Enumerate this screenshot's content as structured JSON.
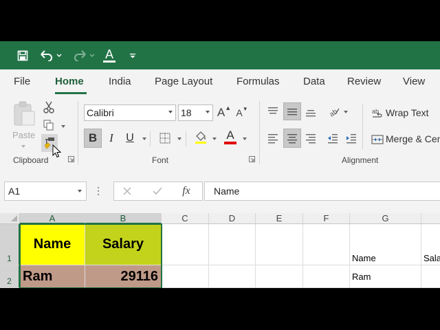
{
  "qat": {
    "icons": [
      "save-icon",
      "undo-icon",
      "redo-icon",
      "font-color-icon",
      "customize-icon"
    ]
  },
  "tabs": [
    "File",
    "Home",
    "India",
    "Page Layout",
    "Formulas",
    "Data",
    "Review",
    "View"
  ],
  "active_tab": "Home",
  "ribbon": {
    "clipboard": {
      "paste_label": "Paste",
      "group_label": "Clipboard"
    },
    "font": {
      "font_name": "Calibri",
      "font_size": "18",
      "grow_label": "A",
      "shrink_label": "A",
      "bold": "B",
      "italic": "I",
      "underline": "U",
      "font_color_label": "A",
      "group_label": "Font"
    },
    "alignment": {
      "wrap_text_label": "Wrap Text",
      "merge_label": "Merge & Center",
      "group_label": "Alignment"
    },
    "colors": {
      "accent": "#217346",
      "font_color_bar": "#e00000",
      "fill_color_bar": "#ffff00"
    }
  },
  "formula_bar": {
    "name_box": "A1",
    "fx": "fx",
    "content": "Name"
  },
  "grid": {
    "columns": [
      "A",
      "B",
      "C",
      "D",
      "E",
      "F",
      "G"
    ],
    "rows": [
      "1",
      "2"
    ],
    "cells": {
      "A1": "Name",
      "B1": "Salary",
      "A2": "Ram",
      "B2": "29116",
      "G1": "Name",
      "H1": "Sala",
      "G2": "Ram"
    },
    "colors": {
      "header_fill": "#ffff00",
      "salary_header_fill": "#c3d31c",
      "data_fill": "#c09a88",
      "selection": "#217346"
    }
  }
}
